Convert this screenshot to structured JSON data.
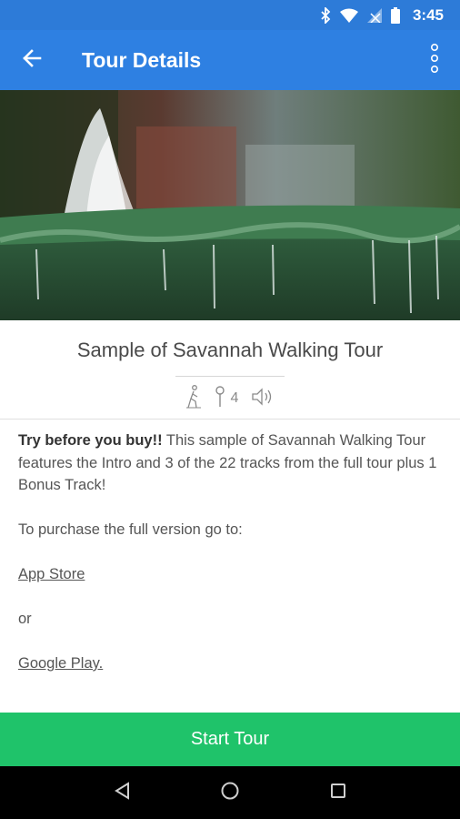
{
  "status_bar": {
    "time": "3:45",
    "icons": [
      "bluetooth-icon",
      "wifi-icon",
      "no-signal-icon",
      "battery-icon"
    ]
  },
  "app_bar": {
    "title": "Tour Details",
    "back_icon": "arrow-back-icon",
    "menu_icon": "more-vert-icon"
  },
  "hero": {
    "description_icon": "fountain-photo"
  },
  "tour": {
    "title": "Sample of Savannah Walking Tour",
    "stops_count": "4",
    "icons": [
      "walking-icon",
      "location-pin-icon",
      "audio-icon"
    ]
  },
  "description": {
    "bold_lead": "Try before you buy!!",
    "intro": " This sample of Savannah Walking Tour features the Intro and 3 of the 22 tracks from the full tour plus 1 Bonus Track!",
    "purchase_text": "To purchase the full version go to:",
    "app_store_link": "App Store",
    "or_text": "or",
    "google_play_link": "Google Play."
  },
  "actions": {
    "start_tour": "Start Tour"
  },
  "colors": {
    "status_bar": "#2d7bd8",
    "app_bar": "#2e80e2",
    "start_button": "#1fc36a",
    "nav_bar": "#000000"
  }
}
